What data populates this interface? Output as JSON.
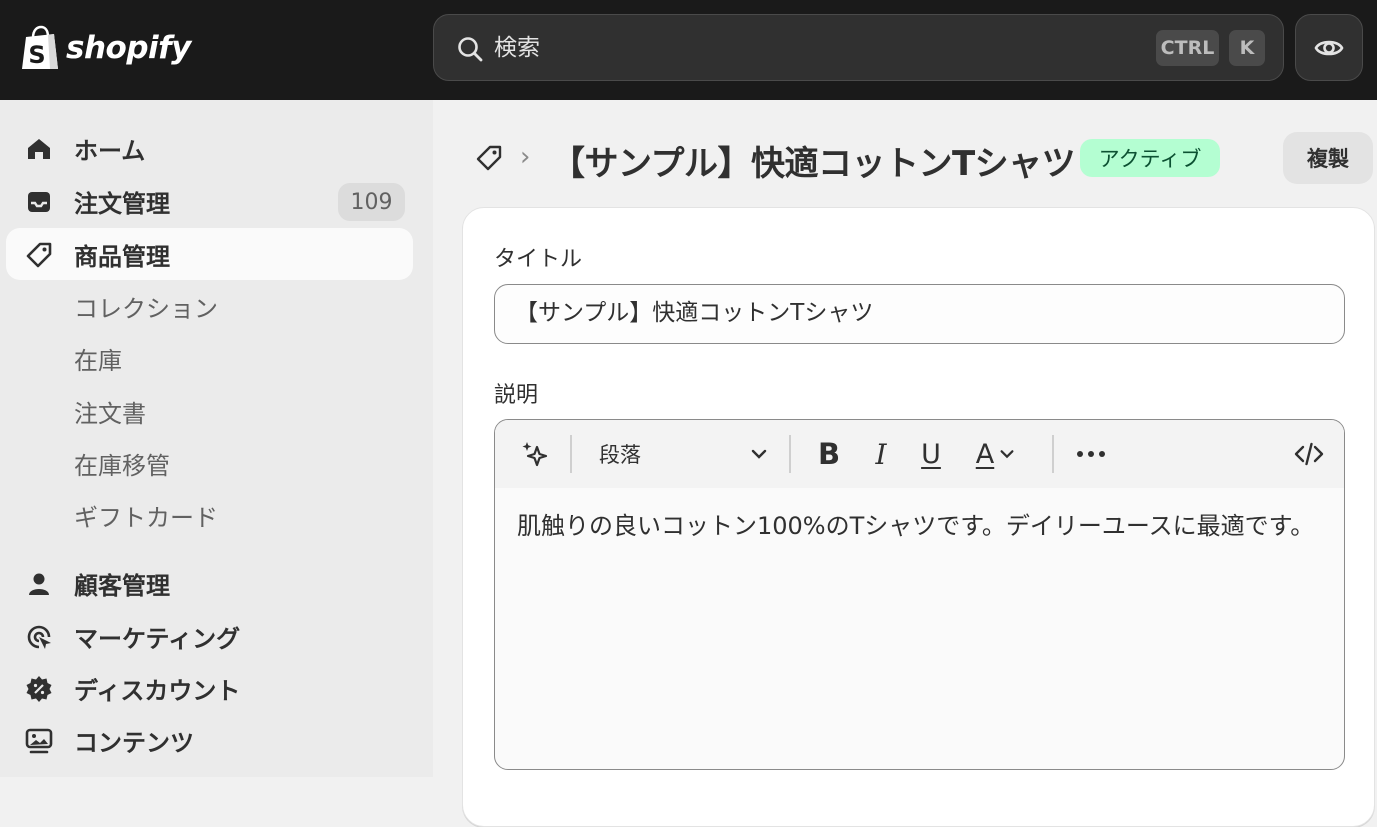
{
  "brand": {
    "name": "shopify"
  },
  "search": {
    "placeholder": "検索",
    "kbd_ctrl": "CTRL",
    "kbd_k": "K"
  },
  "sidebar": {
    "items": [
      {
        "label": "ホーム",
        "icon": "home-icon"
      },
      {
        "label": "注文管理",
        "icon": "inbox-icon",
        "badge": "109"
      },
      {
        "label": "商品管理",
        "icon": "tag-icon",
        "active": true
      },
      {
        "label": "コレクション",
        "sub": true
      },
      {
        "label": "在庫",
        "sub": true
      },
      {
        "label": "注文書",
        "sub": true
      },
      {
        "label": "在庫移管",
        "sub": true
      },
      {
        "label": "ギフトカード",
        "sub": true
      },
      {
        "label": "顧客管理",
        "icon": "person-icon"
      },
      {
        "label": "マーケティング",
        "icon": "target-icon"
      },
      {
        "label": "ディスカウント",
        "icon": "discount-icon"
      },
      {
        "label": "コンテンツ",
        "icon": "content-icon"
      }
    ]
  },
  "page": {
    "title": "【サンプル】快適コットンTシャツ",
    "status": "アクティブ",
    "duplicate_label": "複製"
  },
  "form": {
    "title_label": "タイトル",
    "title_value": "【サンプル】快適コットンTシャツ",
    "description_label": "説明",
    "format_select": "段落",
    "description_text": "肌触りの良いコットン100%のTシャツです。デイリーユースに最適です。"
  },
  "colors": {
    "topbar": "#1a1a1a",
    "sidebar": "#ebebeb",
    "active_badge_bg": "#b4fed2",
    "active_badge_text": "#0c5132"
  }
}
